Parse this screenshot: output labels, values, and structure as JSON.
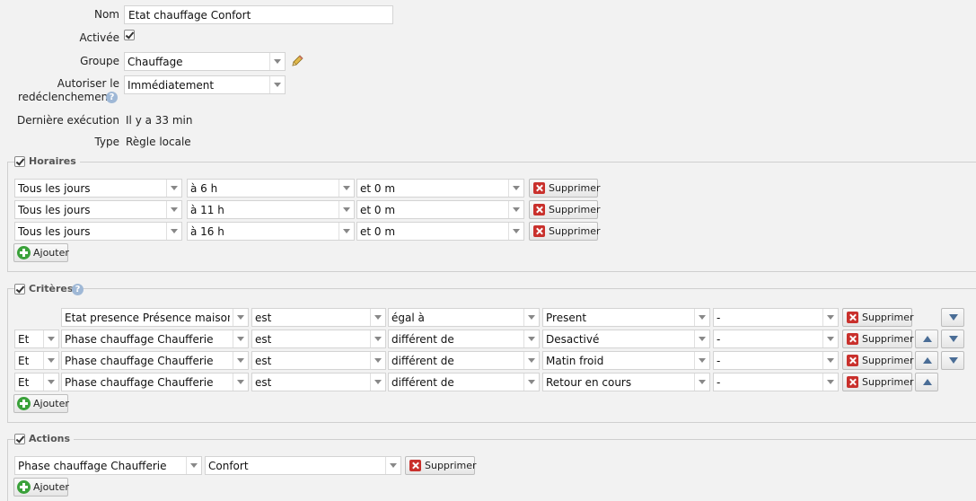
{
  "form": {
    "nom_label": "Nom",
    "nom_value": "Etat chauffage Confort",
    "activee_label": "Activée",
    "groupe_label": "Groupe",
    "groupe_value": "Chauffage",
    "autoriser_label_1": "Autoriser le",
    "autoriser_label_2": "redéclenchement",
    "autoriser_value": "Immédiatement",
    "derniere_label": "Dernière exécution",
    "derniere_value": "Il y a 33 min",
    "type_label": "Type",
    "type_value": "Règle locale"
  },
  "horaires": {
    "title": "Horaires",
    "rows": [
      {
        "jour": "Tous les jours",
        "heure": "à 6 h",
        "minute": "et 0 m"
      },
      {
        "jour": "Tous les jours",
        "heure": "à 11 h",
        "minute": "et 0 m"
      },
      {
        "jour": "Tous les jours",
        "heure": "à 16 h",
        "minute": "et 0 m"
      }
    ],
    "delete_label": "Supprimer",
    "add_label": "Ajouter"
  },
  "criteres": {
    "title": "Critères",
    "rows": [
      {
        "conj": "",
        "device": "Etat presence Présence maison",
        "op": "est",
        "cmp": "égal à",
        "value": "Present",
        "extra": "-"
      },
      {
        "conj": "Et",
        "device": "Phase chauffage Chaufferie",
        "op": "est",
        "cmp": "différent de",
        "value": "Desactivé",
        "extra": "-"
      },
      {
        "conj": "Et",
        "device": "Phase chauffage Chaufferie",
        "op": "est",
        "cmp": "différent de",
        "value": "Matin froid",
        "extra": "-"
      },
      {
        "conj": "Et",
        "device": "Phase chauffage Chaufferie",
        "op": "est",
        "cmp": "différent de",
        "value": "Retour en cours",
        "extra": "-"
      }
    ],
    "delete_label": "Supprimer",
    "add_label": "Ajouter"
  },
  "actions": {
    "title": "Actions",
    "rows": [
      {
        "device": "Phase chauffage Chaufferie",
        "value": "Confort"
      }
    ],
    "delete_label": "Supprimer",
    "add_label": "Ajouter"
  },
  "icons": {
    "checkbox": "checkbox-checked-icon",
    "pencil": "pencil-icon",
    "help": "help-icon",
    "delete": "delete-x-icon",
    "add": "add-plus-icon",
    "up": "arrow-up-icon",
    "down": "arrow-down-icon"
  }
}
